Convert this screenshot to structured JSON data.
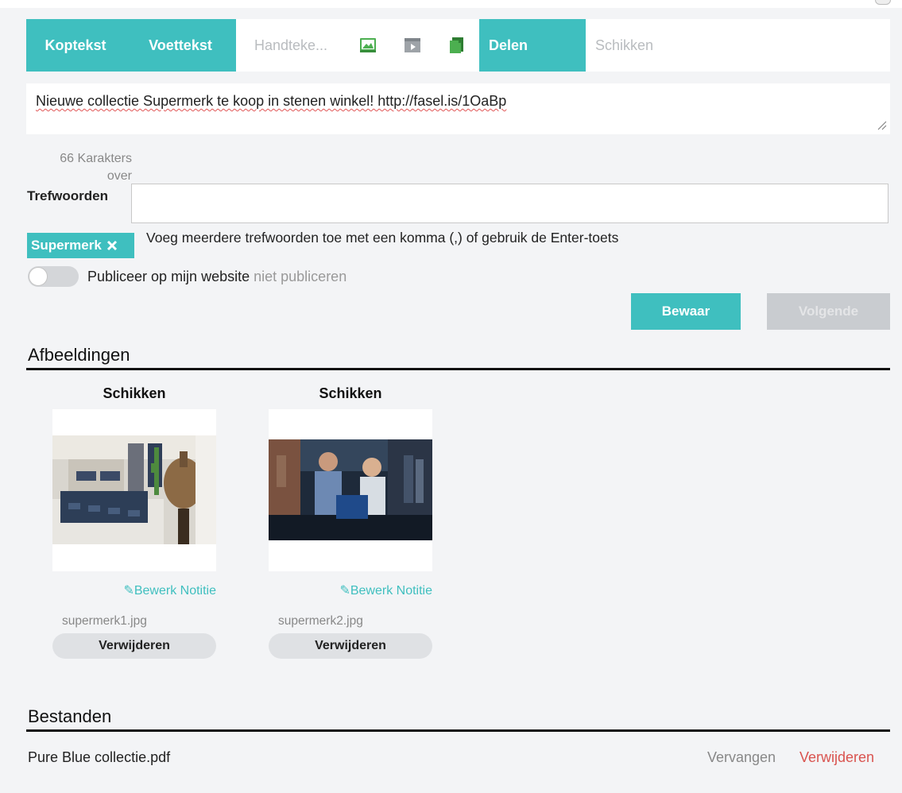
{
  "toolbar": {
    "header": "Koptekst",
    "footer": "Voettekst",
    "signature": "Handteke...",
    "image_icon": "image-icon",
    "video_icon": "video-icon",
    "document_icon": "document-icon",
    "share": "Delen",
    "arrange": "Schikken"
  },
  "message": {
    "text": "Nieuwe collectie Supermerk te koop in stenen winkel! http://fasel.is/1OaBp"
  },
  "char_count": "66 Karakters over",
  "keywords": {
    "label": "Trefwoorden",
    "value": "",
    "tag": "Supermerk",
    "hint": "Voeg meerdere trefwoorden toe met een komma (,) of gebruik de Enter-toets"
  },
  "publish": {
    "label": "Publiceer op mijn website",
    "state": "niet publiceren"
  },
  "buttons": {
    "save": "Bewaar",
    "next": "Volgende"
  },
  "images": {
    "title": "Afbeeldingen",
    "items": [
      {
        "arrange": "Schikken",
        "edit_note": "Bewerk Notitie",
        "filename": "supermerk1.jpg",
        "delete": "Verwijderen"
      },
      {
        "arrange": "Schikken",
        "edit_note": "Bewerk Notitie",
        "filename": "supermerk2.jpg",
        "delete": "Verwijderen"
      }
    ]
  },
  "files": {
    "title": "Bestanden",
    "items": [
      {
        "name": "Pure Blue collectie.pdf",
        "replace": "Vervangen",
        "delete": "Verwijderen"
      }
    ]
  },
  "colors": {
    "accent": "#3fbfbf",
    "danger": "#d9534f"
  }
}
